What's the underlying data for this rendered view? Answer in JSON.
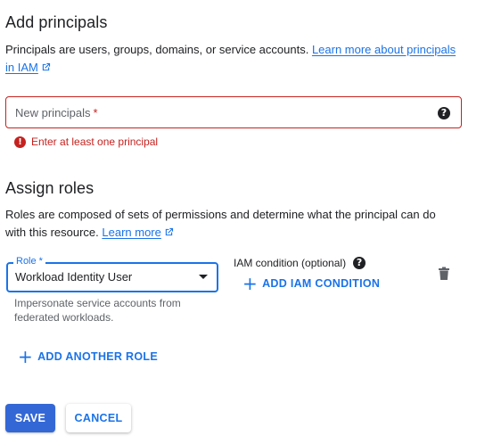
{
  "principals": {
    "title": "Add principals",
    "description": "Principals are users, groups, domains, or service accounts. ",
    "link_line1": "Learn more about principals",
    "link_line2": "in IAM",
    "input_label": "New principals",
    "required_mark": "*",
    "error": "Enter at least one principal"
  },
  "roles": {
    "title": "Assign roles",
    "description_line1": "Roles are composed of sets of permissions and determine what the principal can do",
    "description_line2": "with this resource. ",
    "learn_more": "Learn more",
    "role_label": "Role *",
    "role_value": "Workload Identity User",
    "role_hint": "Impersonate service accounts from federated workloads.",
    "iam_condition_label": "IAM condition (optional)",
    "add_iam_condition": "ADD IAM CONDITION",
    "add_another_role": "ADD ANOTHER ROLE"
  },
  "actions": {
    "save": "SAVE",
    "cancel": "CANCEL"
  },
  "colors": {
    "accent": "#1a73e8",
    "error": "#c5221f",
    "primary_button": "#3367d6"
  },
  "icons": {
    "external_link": "external-link-icon",
    "help": "help-icon",
    "error": "error-icon",
    "delete": "trash-icon",
    "add": "plus-icon",
    "dropdown": "caret-down-icon"
  }
}
